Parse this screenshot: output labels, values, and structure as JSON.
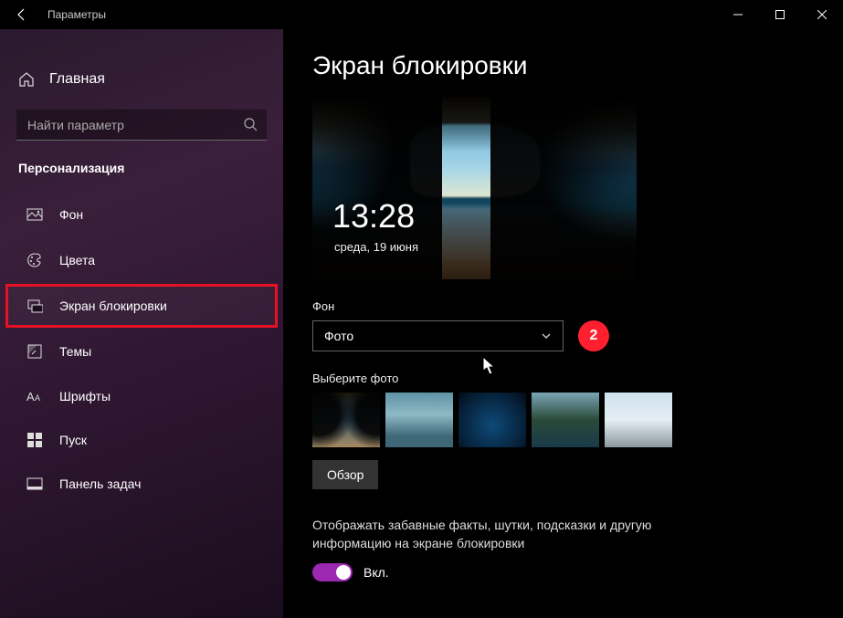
{
  "window": {
    "title": "Параметры"
  },
  "sidebar": {
    "home": "Главная",
    "search_placeholder": "Найти параметр",
    "section": "Персонализация",
    "items": [
      {
        "label": "Фон"
      },
      {
        "label": "Цвета"
      },
      {
        "label": "Экран блокировки"
      },
      {
        "label": "Темы"
      },
      {
        "label": "Шрифты"
      },
      {
        "label": "Пуск"
      },
      {
        "label": "Панель задач"
      }
    ]
  },
  "content": {
    "title": "Экран блокировки",
    "preview": {
      "time": "13:28",
      "date": "среда, 19 июня"
    },
    "bg_label": "Фон",
    "bg_select": "Фото",
    "badge": "2",
    "choose_label": "Выберите фото",
    "browse": "Обзор",
    "fun_facts_desc": "Отображать забавные факты, шутки, подсказки и другую информацию на экране блокировки",
    "toggle_state": "Вкл."
  }
}
